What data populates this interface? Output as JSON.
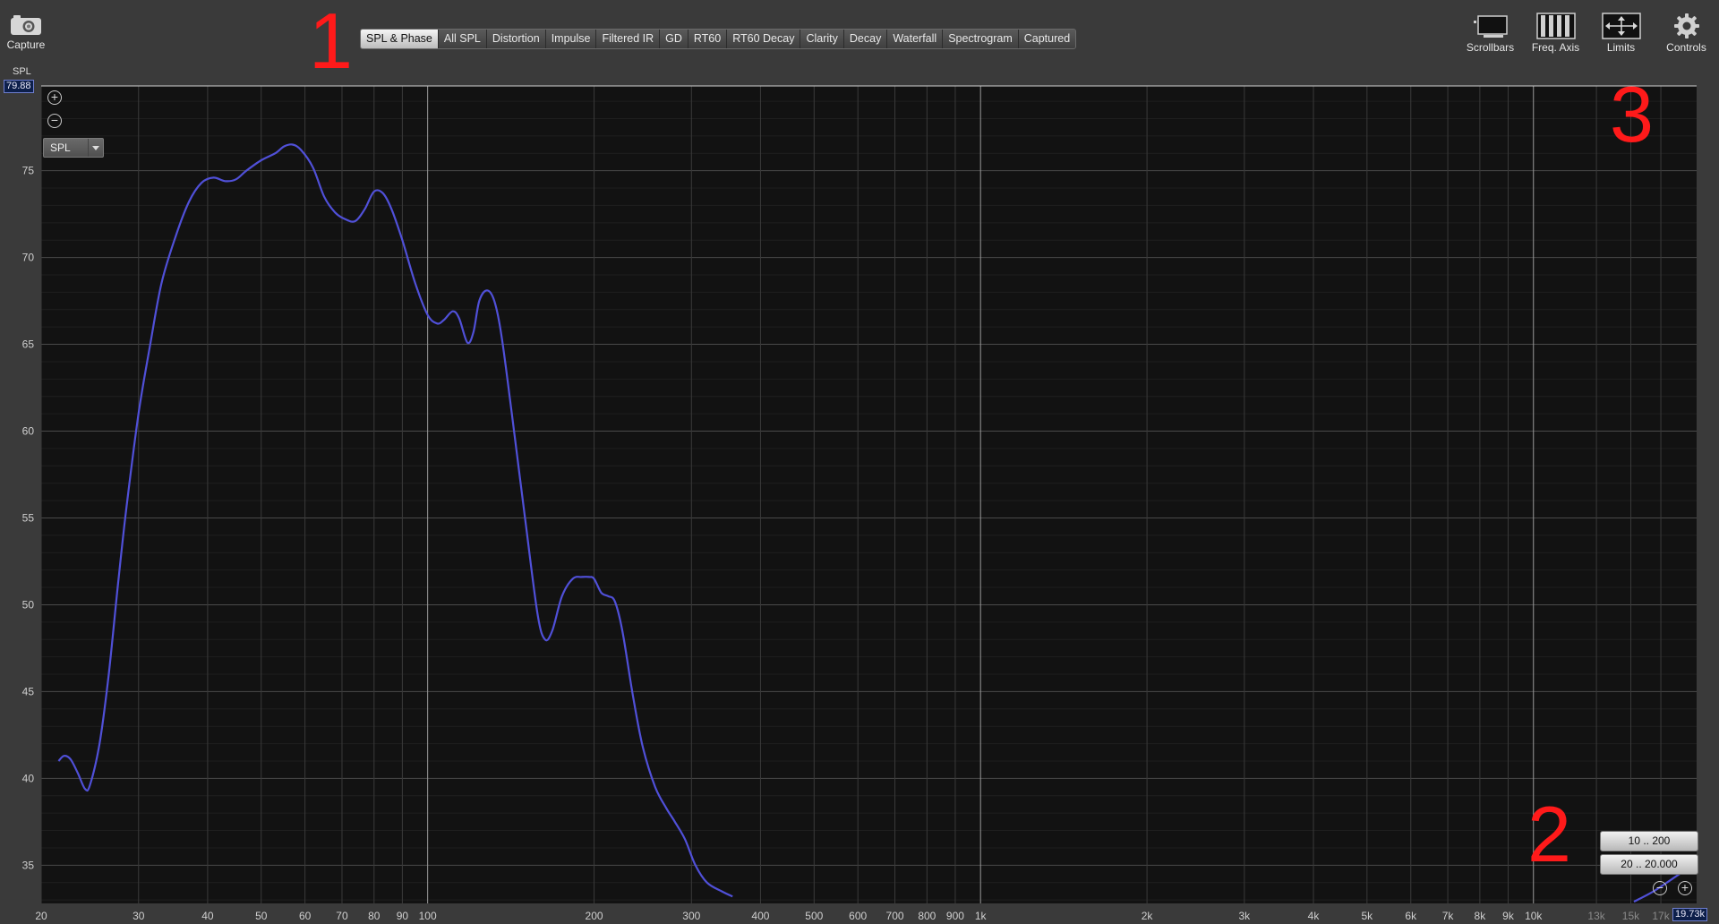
{
  "toolbar": {
    "capture_label": "Capture",
    "tabs": [
      {
        "label": "SPL & Phase",
        "active": true
      },
      {
        "label": "All SPL"
      },
      {
        "label": "Distortion"
      },
      {
        "label": "Impulse"
      },
      {
        "label": "Filtered IR"
      },
      {
        "label": "GD"
      },
      {
        "label": "RT60"
      },
      {
        "label": "RT60 Decay"
      },
      {
        "label": "Clarity"
      },
      {
        "label": "Decay"
      },
      {
        "label": "Waterfall"
      },
      {
        "label": "Spectrogram"
      },
      {
        "label": "Captured"
      }
    ],
    "right_tools": [
      {
        "label": "Scrollbars",
        "icon": "scrollbars-icon"
      },
      {
        "label": "Freq. Axis",
        "icon": "freq-axis-icon"
      },
      {
        "label": "Limits",
        "icon": "limits-icon"
      },
      {
        "label": "Controls",
        "icon": "gear-icon"
      }
    ]
  },
  "graph": {
    "y_axis_title": "SPL",
    "y_cursor_readout": "79.88",
    "x_cursor_readout": "19.73k",
    "trace_selector": "SPL",
    "range_buttons": [
      "10 .. 200",
      "20 .. 20.000"
    ],
    "annotations": [
      "1",
      "2",
      "3"
    ],
    "colors": {
      "background": "#121212",
      "grid": "#3a3a3a",
      "trace": "#5050d8",
      "annotation": "#ff1a1a"
    }
  },
  "chart_data": {
    "type": "line",
    "xscale": "log",
    "xlim": [
      20,
      19730
    ],
    "ylim": [
      32.8,
      79.88
    ],
    "grid": true,
    "x_ticks": [
      {
        "v": 20,
        "label": "20"
      },
      {
        "v": 30,
        "label": "30"
      },
      {
        "v": 40,
        "label": "40"
      },
      {
        "v": 50,
        "label": "50"
      },
      {
        "v": 60,
        "label": "60"
      },
      {
        "v": 70,
        "label": "70"
      },
      {
        "v": 80,
        "label": "80"
      },
      {
        "v": 90,
        "label": "90"
      },
      {
        "v": 100,
        "label": "100"
      },
      {
        "v": 200,
        "label": "200"
      },
      {
        "v": 300,
        "label": "300"
      },
      {
        "v": 400,
        "label": "400"
      },
      {
        "v": 500,
        "label": "500"
      },
      {
        "v": 600,
        "label": "600"
      },
      {
        "v": 700,
        "label": "700"
      },
      {
        "v": 800,
        "label": "800"
      },
      {
        "v": 900,
        "label": "900"
      },
      {
        "v": 1000,
        "label": "1k"
      },
      {
        "v": 2000,
        "label": "2k"
      },
      {
        "v": 3000,
        "label": "3k"
      },
      {
        "v": 4000,
        "label": "4k"
      },
      {
        "v": 5000,
        "label": "5k"
      },
      {
        "v": 6000,
        "label": "6k"
      },
      {
        "v": 7000,
        "label": "7k"
      },
      {
        "v": 8000,
        "label": "8k"
      },
      {
        "v": 9000,
        "label": "9k"
      },
      {
        "v": 10000,
        "label": "10k"
      },
      {
        "v": 13000,
        "label": "13k"
      },
      {
        "v": 15000,
        "label": "15k"
      },
      {
        "v": 17000,
        "label": "17k"
      }
    ],
    "y_ticks": [
      35,
      40,
      45,
      50,
      55,
      60,
      65,
      70,
      75
    ],
    "series": [
      {
        "color": "#5050d8",
        "points": [
          [
            21.5,
            41
          ],
          [
            22,
            41.3
          ],
          [
            22.6,
            41.1
          ],
          [
            23.3,
            40.3
          ],
          [
            24,
            39.4
          ],
          [
            24.5,
            39.6
          ],
          [
            25.5,
            42
          ],
          [
            26.5,
            46
          ],
          [
            27.5,
            51
          ],
          [
            28.5,
            55.5
          ],
          [
            30,
            61
          ],
          [
            31.5,
            65
          ],
          [
            33,
            68.5
          ],
          [
            35,
            71.2
          ],
          [
            37,
            73.2
          ],
          [
            39,
            74.3
          ],
          [
            41,
            74.6
          ],
          [
            43,
            74.4
          ],
          [
            45,
            74.5
          ],
          [
            47,
            75
          ],
          [
            50,
            75.6
          ],
          [
            53,
            76
          ],
          [
            55,
            76.4
          ],
          [
            57,
            76.5
          ],
          [
            59,
            76.2
          ],
          [
            62,
            75.2
          ],
          [
            65,
            73.5
          ],
          [
            68,
            72.6
          ],
          [
            71,
            72.2
          ],
          [
            74,
            72.1
          ],
          [
            77,
            72.8
          ],
          [
            80,
            73.8
          ],
          [
            83,
            73.7
          ],
          [
            86,
            72.8
          ],
          [
            90,
            71
          ],
          [
            95,
            68.5
          ],
          [
            100,
            66.7
          ],
          [
            104,
            66.2
          ],
          [
            107,
            66.4
          ],
          [
            111,
            66.9
          ],
          [
            114,
            66.5
          ],
          [
            118,
            65.1
          ],
          [
            121,
            65.7
          ],
          [
            124,
            67.5
          ],
          [
            128,
            68.1
          ],
          [
            132,
            67.5
          ],
          [
            136,
            65.5
          ],
          [
            142,
            61
          ],
          [
            150,
            55
          ],
          [
            158,
            49.5
          ],
          [
            163,
            48
          ],
          [
            168,
            48.5
          ],
          [
            175,
            50.5
          ],
          [
            183,
            51.5
          ],
          [
            190,
            51.6
          ],
          [
            196,
            51.6
          ],
          [
            200,
            51.5
          ],
          [
            206,
            50.7
          ],
          [
            212,
            50.5
          ],
          [
            218,
            50.2
          ],
          [
            225,
            48.5
          ],
          [
            235,
            44.8
          ],
          [
            245,
            41.8
          ],
          [
            258,
            39.5
          ],
          [
            270,
            38.3
          ],
          [
            280,
            37.5
          ],
          [
            292,
            36.5
          ],
          [
            305,
            35
          ],
          [
            320,
            34
          ],
          [
            340,
            33.5
          ],
          [
            356,
            33.2
          ]
        ]
      },
      {
        "color": "#5050d8",
        "points": [
          [
            15200,
            32.9
          ],
          [
            16500,
            33.5
          ],
          [
            17800,
            34.2
          ],
          [
            19000,
            34.8
          ],
          [
            19730,
            35.2
          ]
        ]
      }
    ]
  }
}
